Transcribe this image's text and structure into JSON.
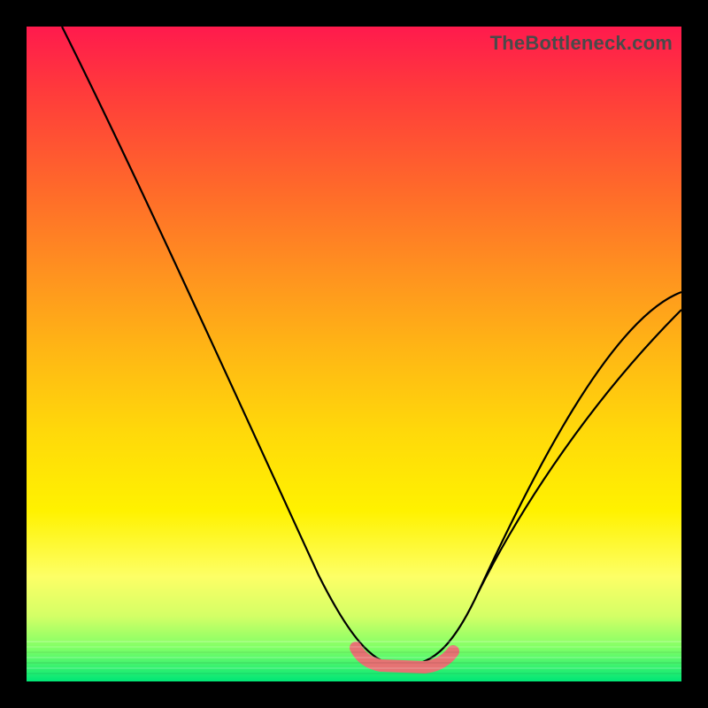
{
  "watermark": "TheBottleneck.com",
  "colors": {
    "frame_bg": "#000000",
    "curve_stroke": "#000000",
    "floor_marker": "#e57373",
    "gradient_top": "#ff1a4d",
    "gradient_bottom": "#00e676"
  },
  "chart_data": {
    "type": "line",
    "title": "",
    "xlabel": "",
    "ylabel": "",
    "xlim": [
      0,
      100
    ],
    "ylim": [
      0,
      100
    ],
    "x": [
      0,
      5,
      10,
      15,
      20,
      25,
      30,
      35,
      40,
      45,
      50,
      52,
      55,
      58,
      60,
      63,
      65,
      70,
      75,
      80,
      85,
      90,
      95,
      100
    ],
    "values": [
      100,
      92,
      84,
      76,
      68,
      59,
      49,
      38,
      27,
      16,
      7,
      3,
      1,
      0,
      0,
      0,
      1,
      4,
      10,
      18,
      27,
      36,
      45,
      55
    ],
    "floor_region_x": [
      52,
      65
    ],
    "annotations": []
  }
}
